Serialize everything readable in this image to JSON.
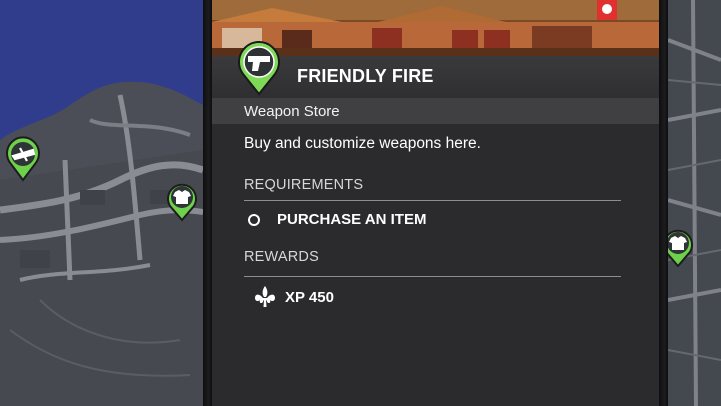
{
  "activity": {
    "title": "FRIENDLY FIRE",
    "type": "Weapon Store",
    "description": "Buy and customize weapons here.",
    "icon": "pistol-icon",
    "accent_color": "#7ed957"
  },
  "requirements": {
    "heading": "REQUIREMENTS",
    "items": [
      {
        "label": "PURCHASE AN ITEM",
        "status_icon": "empty-circle-icon"
      }
    ]
  },
  "rewards": {
    "heading": "REWARDS",
    "items": [
      {
        "label": "XP 450",
        "icon": "fleur-de-lis-icon"
      }
    ]
  },
  "map": {
    "markers": [
      "plane-icon",
      "shirt-icon",
      "shirt-icon"
    ],
    "water_color": "#2f3d8c",
    "land_color": "#4a4d55"
  }
}
